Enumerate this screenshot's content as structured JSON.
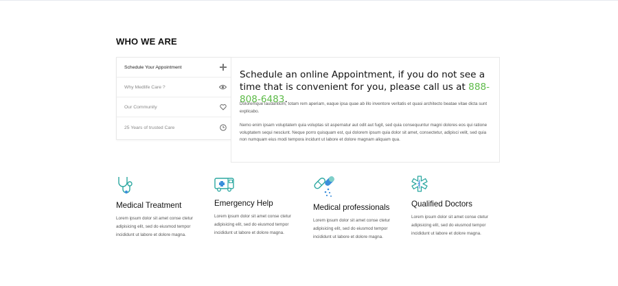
{
  "section": {
    "title": "WHO WE ARE"
  },
  "tabs": [
    {
      "label": "Schedule Your Appointment",
      "icon": "plus-icon",
      "active": true
    },
    {
      "label": "Why Medlife Care ?",
      "icon": "eye-icon",
      "active": false
    },
    {
      "label": "Our Community",
      "icon": "heart-icon",
      "active": false
    },
    {
      "label": "25 Years of trusted Care",
      "icon": "clock-icon",
      "active": false
    }
  ],
  "panel": {
    "heading": "Schedule an online Appointment, if you do not see a time that is convenient for you, please call us at",
    "phone": "888-808-6483",
    "heading_end": ".",
    "paragraph1": "Doloremque laudantium, totam rem aperiam, eaque ipsa quae ab illo inventore veritatis et quasi architecto beatae vitae dicta sunt explicabo.",
    "paragraph2": "Nemo enim ipsam voluptatem quia voluptas sit aspernatur aut odit aut fugit, sed quia consequuntur magni dolores eos qui ratione voluptatem sequi nesciunt. Neque porro quisquam est, qui dolorem ipsum quia dolor sit amet, consectetur, adipisci velit, sed quia non numquam eius modi tempora incidunt ut labore et dolore magnam aliquam qua."
  },
  "features": [
    {
      "title": "Medical Treatment",
      "icon": "stethoscope-icon",
      "desc": "Lorem ipsum dolor sit amet conse ctetur adipisicing elit, sed do eiusmod tempor incididunt ut labore et dolore magna."
    },
    {
      "title": "Emergency Help",
      "icon": "ambulance-icon",
      "desc": "Lorem ipsum dolor sit amet conse ctetur adipisicing elit, sed do eiusmod tempor incididunt ut labore et dolore magna."
    },
    {
      "title": "Medical professionals",
      "icon": "pills-icon",
      "desc": "Lorem ipsum dolor sit amet conse ctetur adipisicing elit, sed do eiusmod tempor incididunt ut labore et dolore magna."
    },
    {
      "title": "Qualified Doctors",
      "icon": "medical-star-icon",
      "desc": "Lorem ipsum dolor sit amet conse ctetur adipisicing elit, sed do eiusmod tempor incididunt ut labore et dolore magna."
    }
  ],
  "colors": {
    "accent_green": "#5cba47",
    "icon_teal": "#2aa7a0"
  }
}
